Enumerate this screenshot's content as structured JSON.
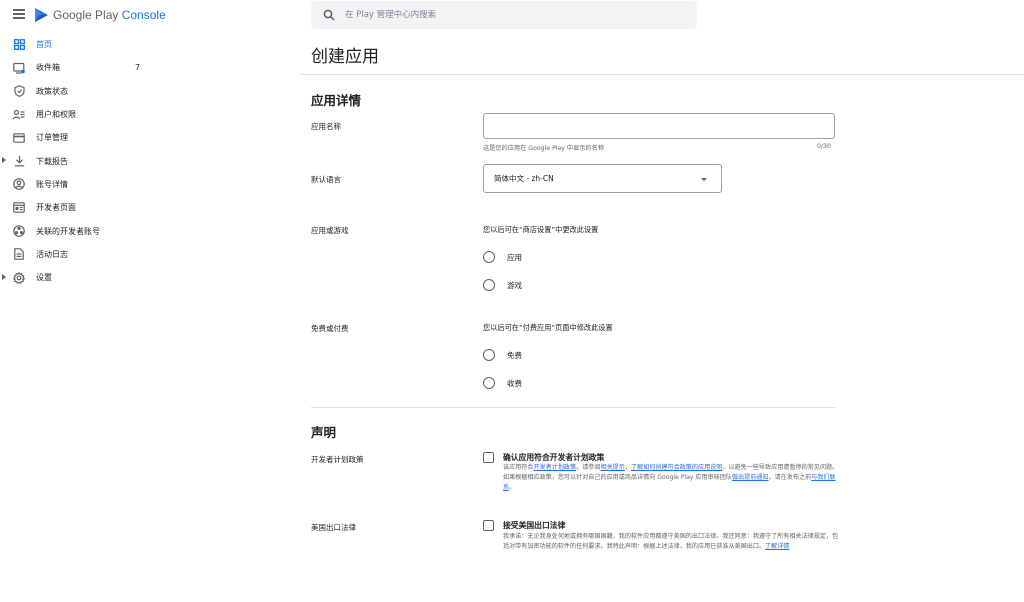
{
  "app": {
    "logo_prefix": "Google Play",
    "logo_suffix": "Console"
  },
  "search": {
    "placeholder": "在 Play 管理中心内搜索"
  },
  "nav": [
    {
      "label": "首页",
      "icon": "dashboard-icon",
      "active": true
    },
    {
      "label": "收件箱",
      "icon": "inbox-icon",
      "count": "7"
    },
    {
      "label": "政策状态",
      "icon": "shield-check-icon"
    },
    {
      "label": "用户和权限",
      "icon": "users-permissions-icon"
    },
    {
      "label": "订单管理",
      "icon": "credit-card-icon"
    },
    {
      "label": "下载报告",
      "icon": "download-icon",
      "expandable": true
    },
    {
      "label": "账号详情",
      "icon": "account-circle-icon"
    },
    {
      "label": "开发者页面",
      "icon": "developer-page-icon"
    },
    {
      "label": "关联的开发者账号",
      "icon": "linked-accounts-icon"
    },
    {
      "label": "活动日志",
      "icon": "document-icon"
    },
    {
      "label": "设置",
      "icon": "gear-icon",
      "expandable": true
    }
  ],
  "page": {
    "title": "创建应用"
  },
  "details": {
    "section_title": "应用详情",
    "app_name": {
      "label": "应用名称",
      "value": "",
      "hint": "这是您的应用在 Google Play 中显示的名称",
      "counter": "0/30"
    },
    "language": {
      "label": "默认语言",
      "value": "简体中文 - zh-CN"
    },
    "app_or_game": {
      "label": "应用或游戏",
      "note": "您以后可在“商店设置”中更改此设置",
      "options": [
        "应用",
        "游戏"
      ]
    },
    "free_or_paid": {
      "label": "免费或付费",
      "note": "您以后可在“付费应用”页面中修改此设置",
      "options": [
        "免费",
        "收费"
      ]
    }
  },
  "declarations": {
    "section_title": "声明",
    "policy": {
      "label": "开发者计划政策",
      "title": "确认应用符合开发者计划政策",
      "text_1": "该应用符合",
      "link_1": "开发者计划政策",
      "text_2": "。请参阅",
      "link_2": "相关提示",
      "text_3": "，",
      "link_3": "了解如何创建符合政策的应用说明",
      "text_4": "，以避免一些导致应用遭暂停的常见问题。如果根据相应政策，您可以针对自己的应用或商品详情向 Google Play 应用审核团队",
      "link_4": "做出提前通知",
      "text_5": "，请在发布之前",
      "link_5": "与我们联系",
      "text_6": "。"
    },
    "export": {
      "label": "美国出口法律",
      "title": "接受美国出口法律",
      "text_1": "我承诺：无论我身处何地或拥有哪国国籍，我的软件应用都遵守美国的出口法律。我还同意：我遵守了所有相关法律规定，包括对带有加密功能的软件的任何要求。我特此声明：根据上述法律，我的应用已获准从美国出口。",
      "link_1": "了解详情"
    }
  },
  "colors": {
    "accent": "#1a73e8",
    "text": "#202124",
    "muted": "#5f6368",
    "divider": "#e0e0e0",
    "search_bg": "#f1f3f4"
  }
}
